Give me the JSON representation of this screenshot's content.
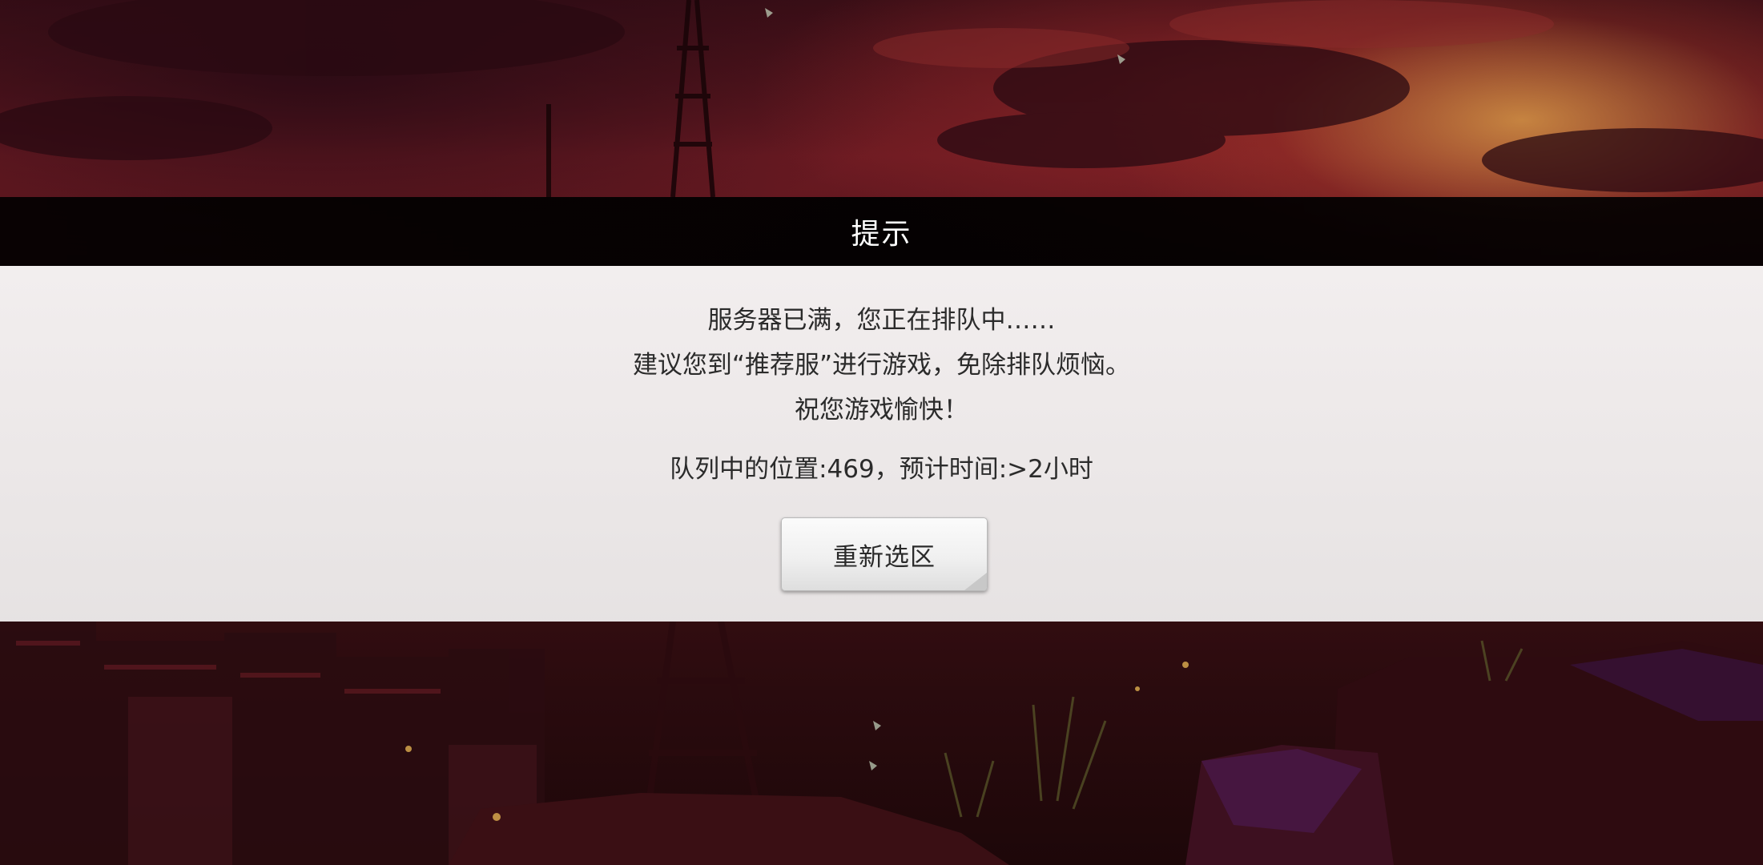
{
  "dialog": {
    "title": "提示",
    "message_lines": [
      "服务器已满，您正在排队中……",
      "建议您到“推荐服”进行游戏，免除排队烦恼。",
      "祝您游戏愉快！"
    ],
    "queue_status": "队列中的位置:469，预计时间:>2小时",
    "retry_button_label": "重新选区"
  },
  "colors": {
    "sky_dark": "#3a0e16",
    "sky_red": "#6b1a22",
    "sunset_glow": "#d69646",
    "title_bar_bg": "#000000",
    "panel_bg": "#f4f2f2",
    "text": "#2b2b2b"
  }
}
